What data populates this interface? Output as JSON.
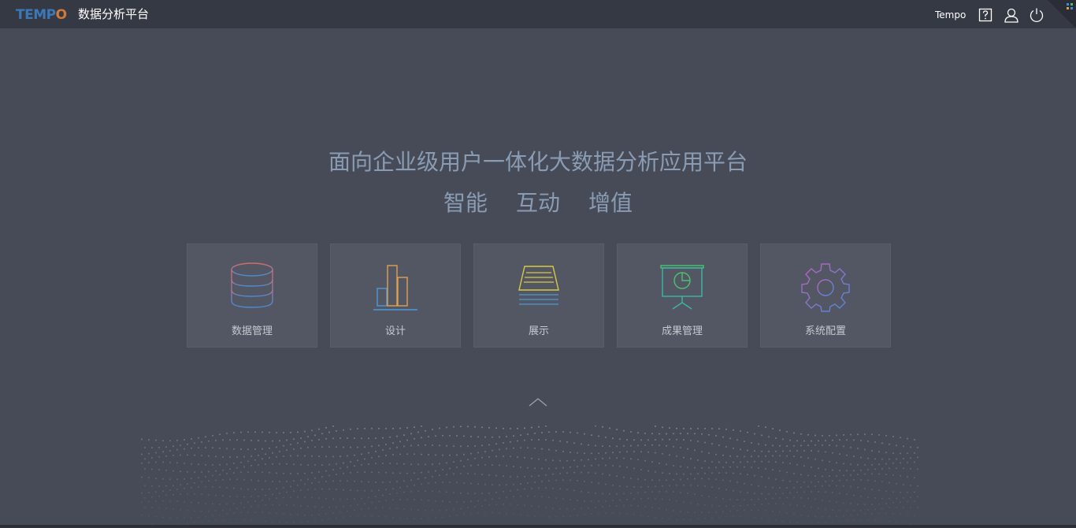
{
  "header": {
    "logo_text": "TEMPO",
    "app_title": "数据分析平台",
    "user_name": "Tempo",
    "icons": [
      "help-icon",
      "user-icon",
      "power-icon"
    ]
  },
  "hero": {
    "headline": "面向企业级用户一体化大数据分析应用平台",
    "slogans": [
      "智能",
      "互动",
      "增值"
    ]
  },
  "tiles": [
    {
      "label": "数据管理",
      "icon": "database-icon"
    },
    {
      "label": "设计",
      "icon": "bar-chart-icon"
    },
    {
      "label": "展示",
      "icon": "document-stack-icon"
    },
    {
      "label": "成果管理",
      "icon": "presentation-board-icon"
    },
    {
      "label": "系统配置",
      "icon": "gear-icon"
    }
  ],
  "colors": {
    "background": "#474b57",
    "topbar": "#353943",
    "tile": "#535763",
    "headline": "#8a9cb3"
  }
}
